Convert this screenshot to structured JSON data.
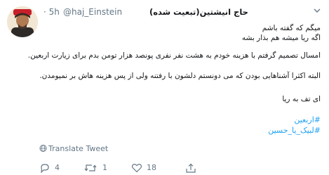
{
  "tweet": {
    "display_name": "حاج انیشتین(تبعیت شده)",
    "handle": "@haj_Einstein",
    "time": "· 5h",
    "lines": [
      "میگم که گفته باشم",
      "اگه ریا میشه هم بذار بشه",
      "امسال تصمیم گرفتم با هزینه خودم به هشت نفر نفری پونصد هزار تومن بدم برای زیارت اربعین.",
      "البته اکثرا آشناهایی بودن که می دونستم دلشون با رفتنه ولی از پس هزینه هاش بر نمیومدن.",
      "ای تف به ریا"
    ],
    "hashtags": [
      "#اربعین",
      "#لبیک_یا_حسین"
    ]
  },
  "translate_label": "Translate Tweet",
  "actions": {
    "reply_count": "4",
    "retweet_count": "1",
    "like_count": "18"
  },
  "icons": {
    "header_menu": "chevron-down-icon",
    "translate": "globe-icon",
    "reply": "reply-icon",
    "retweet": "retweet-icon",
    "like": "heart-icon",
    "share": "share-icon"
  },
  "colors": {
    "link": "#1da1f2",
    "muted": "#657786",
    "text": "#14171a"
  }
}
